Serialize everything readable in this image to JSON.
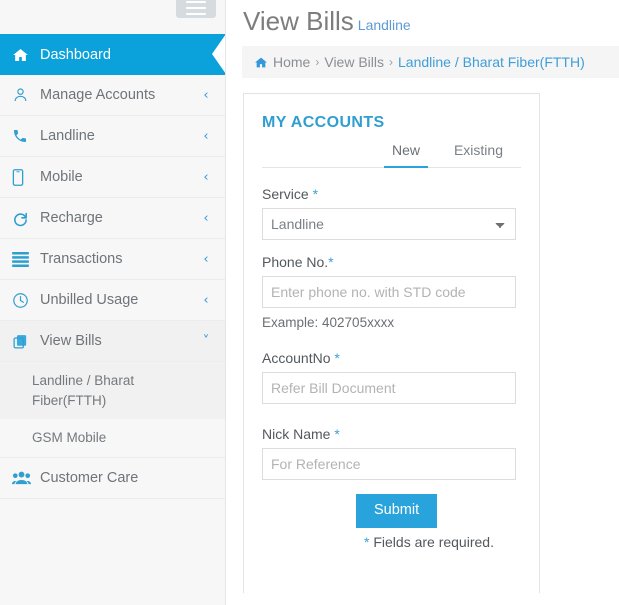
{
  "theme": {
    "accent": "#0ba1db",
    "accent_button": "#29a3dc",
    "sidebar_bg": "#f7f7f7",
    "link_blue": "#3f9ed8",
    "text_gray": "#6f7479"
  },
  "sidebar": {
    "menu_toggle_label": "menu",
    "items": [
      {
        "label": "Dashboard",
        "icon": "home-icon",
        "active": true,
        "chevron": ""
      },
      {
        "label": "Manage Accounts",
        "icon": "user-icon",
        "active": false,
        "chevron": "‹"
      },
      {
        "label": "Landline",
        "icon": "phone-icon",
        "active": false,
        "chevron": "‹"
      },
      {
        "label": "Mobile",
        "icon": "mobile-icon",
        "active": false,
        "chevron": "‹"
      },
      {
        "label": "Recharge",
        "icon": "refresh-icon",
        "active": false,
        "chevron": "‹"
      },
      {
        "label": "Transactions",
        "icon": "list-icon",
        "active": false,
        "chevron": "‹"
      },
      {
        "label": "Unbilled Usage",
        "icon": "clock-icon",
        "active": false,
        "chevron": "‹"
      },
      {
        "label": "View Bills",
        "icon": "copy-icon",
        "active": false,
        "chevron": "˅",
        "expanded": true
      },
      {
        "label": "Customer Care",
        "icon": "users-icon",
        "active": false,
        "chevron": ""
      }
    ],
    "view_bills_submenu": [
      {
        "label": "Landline / Bharat Fiber(FTTH)",
        "selected": true
      },
      {
        "label": "GSM Mobile",
        "selected": false
      }
    ]
  },
  "header": {
    "title": "View Bills",
    "subtitle": "Landline"
  },
  "breadcrumb": {
    "home": "Home",
    "sep": "›",
    "level2": "View Bills",
    "current": "Landline / Bharat Fiber(FTTH)"
  },
  "card": {
    "title": "MY ACCOUNTS",
    "tabs": [
      {
        "label": "New",
        "active": true
      },
      {
        "label": "Existing",
        "active": false
      }
    ],
    "form": {
      "service": {
        "label": "Service",
        "required_mark": "*",
        "value": "Landline",
        "options": [
          "Landline"
        ]
      },
      "phone": {
        "label": "Phone No.",
        "required_mark": "*",
        "placeholder": "Enter phone no. with STD code",
        "value": "",
        "hint": "Example: 402705xxxx"
      },
      "account": {
        "label": "AccountNo",
        "required_mark": "*",
        "placeholder": "Refer Bill Document",
        "value": ""
      },
      "nickname": {
        "label": "Nick Name",
        "required_mark": "*",
        "placeholder": "For Reference",
        "value": ""
      },
      "submit_label": "Submit",
      "required_note_star": "*",
      "required_note_text": " Fields are required."
    }
  }
}
